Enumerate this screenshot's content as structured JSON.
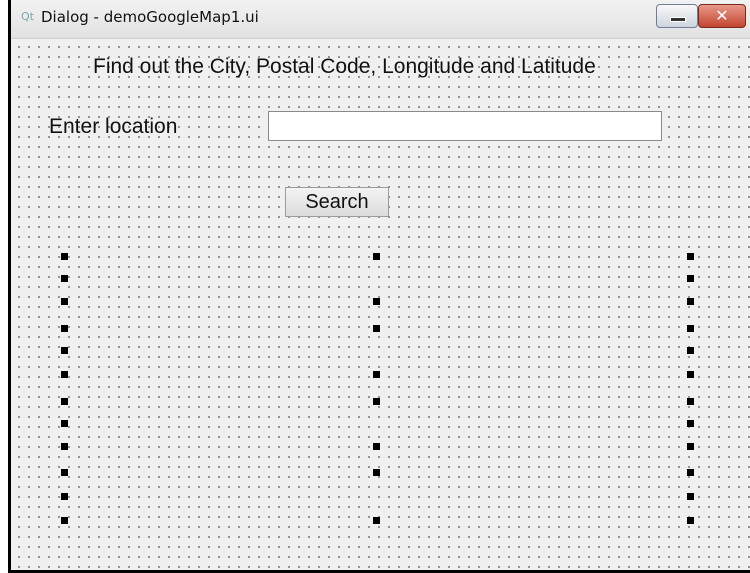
{
  "window": {
    "title": "Dialog - demoGoogleMap1.ui",
    "app_icon": "qt-icon",
    "minimize_icon": "minimize-icon",
    "close_icon": "close-icon",
    "close_glyph": "✕"
  },
  "form": {
    "heading": "Find out the City, Postal Code, Longitude and Latitude",
    "location_label": "Enter location",
    "location_value": "",
    "search_label": "Search"
  },
  "colors": {
    "close_button": "#c2442e",
    "grid_dot": "#7c7c7c"
  }
}
